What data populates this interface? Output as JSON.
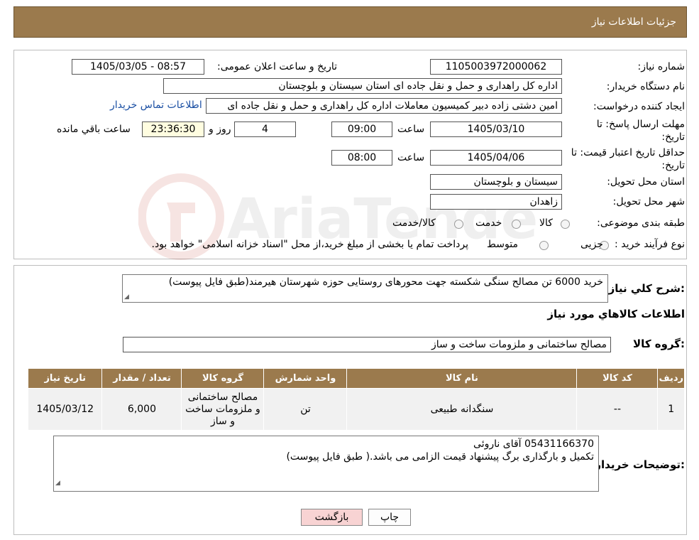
{
  "header": {
    "title": "جزئیات اطلاعات نیاز"
  },
  "form": {
    "need_number_label": "شماره نیاز:",
    "need_number": "1105003972000062",
    "announce_label": "تاریخ و ساعت اعلان عمومی:",
    "announce_value": "1405/03/05 - 08:57",
    "buyer_org_label": "نام دستگاه خریدار:",
    "buyer_org": "اداره کل راهداری و حمل و نقل جاده ای استان سیستان و بلوچستان",
    "requester_label": "ایجاد کننده درخواست:",
    "requester": "امین دشتی زاده دبیر کمیسیون معاملات اداره کل راهداری و حمل و نقل جاده ای",
    "contact_link": "اطلاعات تماس خریدار",
    "deadline_label": "مهلت ارسال پاسخ: تا تاریخ:",
    "deadline_date": "1405/03/10",
    "time_label": "ساعت",
    "deadline_time": "09:00",
    "days_value": "4",
    "days_label": "روز و",
    "remaining_time": "23:36:30",
    "remaining_label": "ساعت باقي مانده",
    "validity_label": "حداقل تاریخ اعتبار قیمت: تا تاریخ:",
    "validity_date": "1405/04/06",
    "validity_time": "08:00",
    "province_label": "استان محل تحویل:",
    "province": "سیستان و بلوچستان",
    "city_label": "شهر محل تحویل:",
    "city": "زاهدان",
    "category_label": "طبقه بندی موضوعی:",
    "category_options": [
      "کالا",
      "خدمت",
      "کالا/خدمت"
    ],
    "process_label": "نوع فرآیند خرید :",
    "process_options": [
      "جزیی",
      "متوسط"
    ],
    "process_note": "پرداخت تمام یا بخشی از مبلغ خرید،از محل \"اسناد خزانه اسلامی\" خواهد بود."
  },
  "summary": {
    "label": "شرح کلي نیاز:",
    "text": "خرید 6000 تن مصالح سنگی شکسته جهت محورهای روستایی حوزه شهرستان هیرمند(طبق فایل پیوست)"
  },
  "goods": {
    "section_title": "اطلاعات کالاهاي مورد نیاز",
    "group_label": "گروه کالا:",
    "group_value": "مصالح ساختمانی و ملزومات ساخت و ساز",
    "columns": [
      "ردیف",
      "کد کالا",
      "نام کالا",
      "واحد شمارش",
      "گروه کالا",
      "تعداد / مقدار",
      "تاریخ نیاز"
    ],
    "rows": [
      [
        "1",
        "--",
        "سنگدانه طبیعی",
        "تن",
        "مصالح ساختمانی و ملزومات ساخت و ساز",
        "6,000",
        "1405/03/12"
      ]
    ]
  },
  "buyer_notes": {
    "label": "توضیحات خریدار:",
    "line1": "05431166370 آقای ناروئی",
    "line2": "تکمیل و بارگذاری برگ پیشنهاد قیمت الزامی می باشد.( طبق فایل پیوست)"
  },
  "buttons": {
    "print": "چاپ",
    "back": "بازگشت"
  },
  "colors": {
    "header_bg": "#9b7a4d",
    "link": "#1a4fa3",
    "back_button_bg": "#f8d3d3"
  }
}
